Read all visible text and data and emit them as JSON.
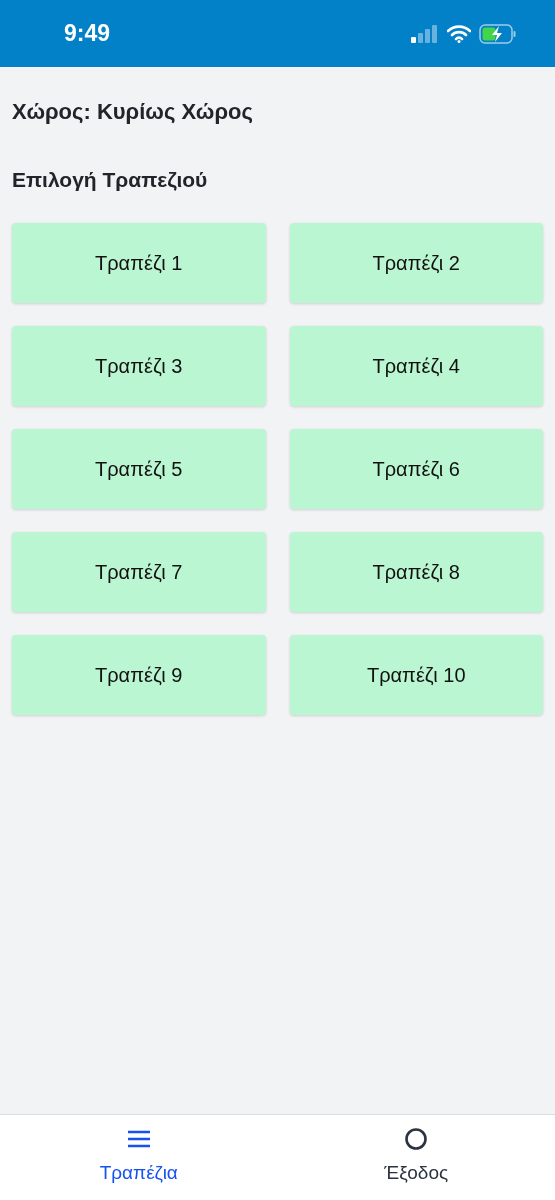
{
  "status_bar": {
    "time": "9:49"
  },
  "venue": "Χώρος: Κυρίως Χώρος",
  "section_title": "Επιλογή Τραπεζιού",
  "tables": [
    {
      "label": "Τραπέζι 1"
    },
    {
      "label": "Τραπέζι 2"
    },
    {
      "label": "Τραπέζι 3"
    },
    {
      "label": "Τραπέζι 4"
    },
    {
      "label": "Τραπέζι 5"
    },
    {
      "label": "Τραπέζι 6"
    },
    {
      "label": "Τραπέζι 7"
    },
    {
      "label": "Τραπέζι 8"
    },
    {
      "label": "Τραπέζι 9"
    },
    {
      "label": "Τραπέζι 10"
    }
  ],
  "tab_bar": [
    {
      "label": "Τραπέζια",
      "kind": "menu",
      "selected": true
    },
    {
      "label": "Έξοδος",
      "kind": "circle",
      "selected": false
    }
  ]
}
